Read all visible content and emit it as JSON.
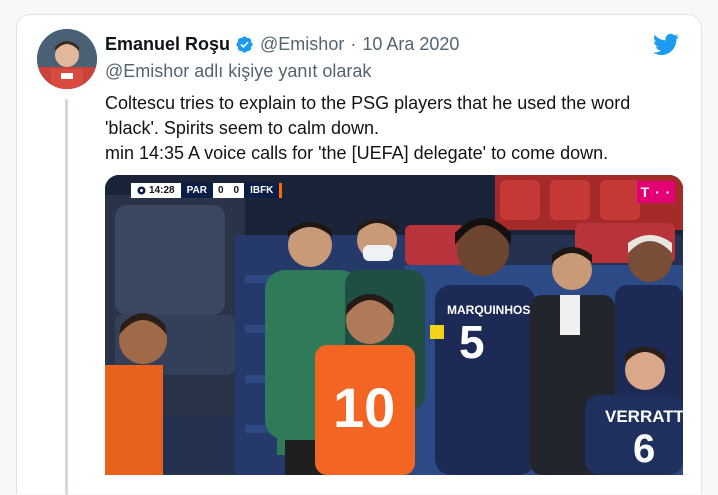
{
  "tweet": {
    "display_name": "Emanuel Roşu",
    "handle": "@Emishor",
    "separator": "·",
    "date": "10 Ara 2020",
    "reply_context": "@Emishor adlı kişiye yanıt olarak",
    "text_lines": [
      "Coltescu tries to explain to the PSG players that he used the word",
      "'black'. Spirits seem to calm down.",
      "min 14:35 A voice calls for 'the [UEFA] delegate' to come down."
    ]
  },
  "icons": {
    "avatar": "avatar",
    "verified": "verified-badge-icon",
    "brand": "twitter-bird-icon"
  },
  "colors": {
    "twitter_blue": "#1d9bf0",
    "text_primary": "#0f1419",
    "text_muted": "#536471",
    "psg_navy": "#1c2a55",
    "basaksehir_orange": "#f26522",
    "telekom_magenta": "#e20074"
  },
  "media": {
    "scorebug": {
      "clock": "14:28",
      "home_team": "PAR",
      "home_score": "0",
      "away_score": "0",
      "away_team": "IBFK"
    },
    "broadcaster_logo": "T · ·",
    "jersey_texts": {
      "marquinhos_name": "MARQUINHOS",
      "marquinhos_number": "5",
      "verratti_name": "VERRATTI",
      "verratti_number": "6",
      "orange_number": "10"
    }
  }
}
